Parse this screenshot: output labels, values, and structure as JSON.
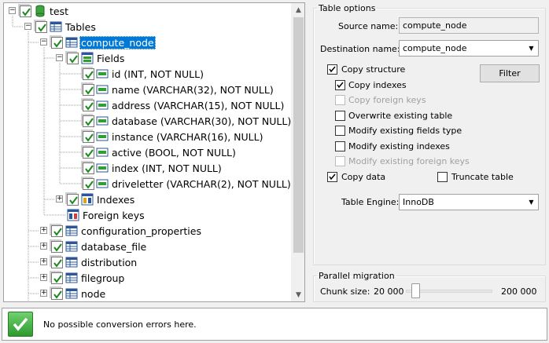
{
  "tree": {
    "nodes": [
      {
        "label": "test",
        "icon": "database-icon",
        "checked": true
      },
      {
        "label": "Tables",
        "icon": "tables-folder-icon",
        "checked": true
      },
      {
        "label": "compute_node",
        "icon": "table-icon",
        "checked": true,
        "selected": true
      },
      {
        "label": "Fields",
        "icon": "fields-icon",
        "checked": true
      },
      {
        "label": "id (INT, NOT NULL)",
        "icon": "field-icon",
        "checked": true
      },
      {
        "label": "name (VARCHAR(32), NOT NULL)",
        "icon": "field-icon",
        "checked": true
      },
      {
        "label": "address (VARCHAR(15), NOT NULL)",
        "icon": "field-icon",
        "checked": true
      },
      {
        "label": "database (VARCHAR(30), NOT NULL)",
        "icon": "field-icon",
        "checked": true
      },
      {
        "label": "instance (VARCHAR(16), NULL)",
        "icon": "field-icon",
        "checked": true
      },
      {
        "label": "active (BOOL, NOT NULL)",
        "icon": "field-icon",
        "checked": true
      },
      {
        "label": "index (INT, NOT NULL)",
        "icon": "field-icon",
        "checked": true
      },
      {
        "label": "driveletter (VARCHAR(2), NOT NULL)",
        "icon": "field-icon",
        "checked": true
      },
      {
        "label": "Indexes",
        "icon": "indexes-icon",
        "checked": true
      },
      {
        "label": "Foreign keys",
        "icon": "foreign-keys-icon",
        "checked": false
      },
      {
        "label": "configuration_properties",
        "icon": "table-icon",
        "checked": true
      },
      {
        "label": "database_file",
        "icon": "table-icon",
        "checked": true
      },
      {
        "label": "distribution",
        "icon": "table-icon",
        "checked": true
      },
      {
        "label": "filegroup",
        "icon": "table-icon",
        "checked": true
      },
      {
        "label": "node",
        "icon": "table-icon",
        "checked": true
      }
    ]
  },
  "table_options": {
    "legend": "Table options",
    "source_name_label": "Source name:",
    "source_name_value": "compute_node",
    "destination_name_label": "Destination name:",
    "destination_name_value": "compute_node",
    "filter_button": "Filter",
    "copy_structure": {
      "label": "Copy structure",
      "checked": true
    },
    "copy_indexes": {
      "label": "Copy indexes",
      "checked": true
    },
    "copy_foreign_keys": {
      "label": "Copy foreign keys",
      "checked": false,
      "disabled": true
    },
    "overwrite_existing_table": {
      "label": "Overwrite existing table",
      "checked": false
    },
    "modify_existing_fields_type": {
      "label": "Modify existing fields type",
      "checked": false
    },
    "modify_existing_indexes": {
      "label": "Modify existing indexes",
      "checked": false
    },
    "modify_existing_foreign_keys": {
      "label": "Modify existing foreign keys",
      "checked": false,
      "disabled": true
    },
    "copy_data": {
      "label": "Copy data",
      "checked": true
    },
    "truncate_table": {
      "label": "Truncate table",
      "checked": false
    },
    "table_engine_label": "Table Engine:",
    "table_engine_value": "InnoDB"
  },
  "parallel_migration": {
    "legend": "Parallel migration",
    "chunk_size_label": "Chunk size:",
    "min_label": "20 000",
    "max_label": "200 000",
    "slider_fraction": 0.07
  },
  "status": {
    "message": "No possible conversion errors here."
  }
}
